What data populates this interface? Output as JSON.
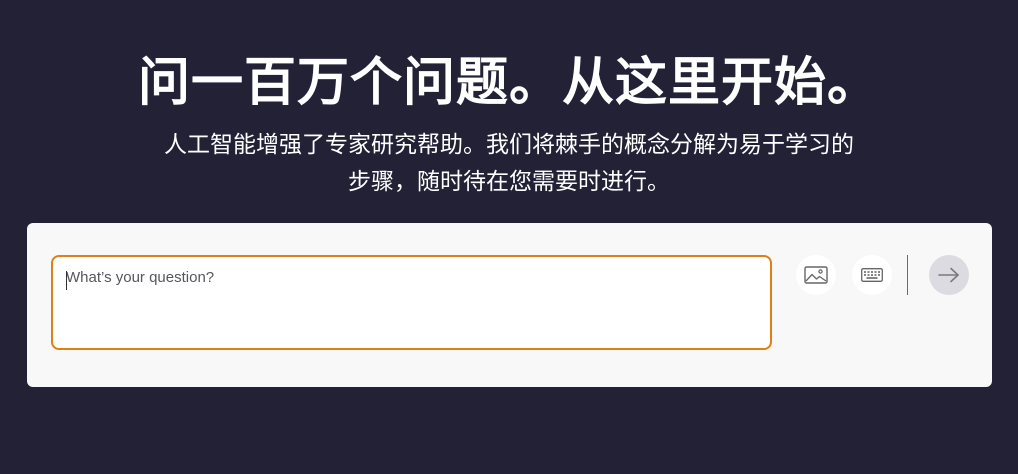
{
  "hero": {
    "title": "问一百万个问题。从这里开始。",
    "subtitle": "人工智能增强了专家研究帮助。我们将棘手的概念分解为易于学习的步骤，随时待在您需要时进行。"
  },
  "question": {
    "placeholder": "What’s your question?",
    "value": ""
  },
  "toolbar": {
    "image_icon": "image-icon",
    "keyboard_icon": "keyboard-icon",
    "submit_icon": "arrow-right-icon"
  },
  "colors": {
    "background": "#232136",
    "card": "#f8f8f8",
    "input_border": "#e07f16",
    "submit_bg": "#dcdbe1"
  }
}
